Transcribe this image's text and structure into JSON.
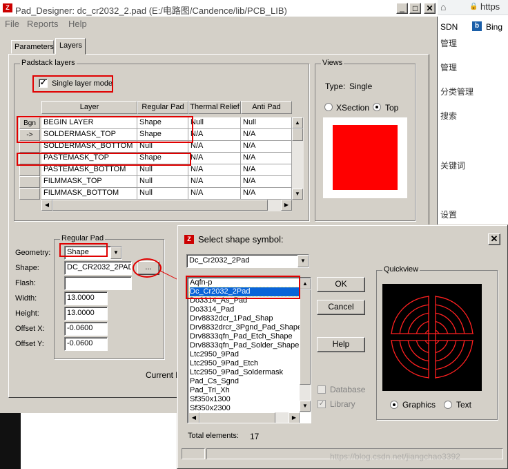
{
  "main_window": {
    "title": "Pad_Designer: dc_cr2032_2.pad (E:/电路图/Candence/lib/PCB_LIB)",
    "menu": [
      "File",
      "Reports",
      "Help"
    ],
    "tabs": [
      "Parameters",
      "Layers"
    ],
    "padstack_group": "Padstack layers",
    "single_layer_mode": "Single layer mode",
    "columns": [
      "Layer",
      "Regular Pad",
      "Thermal Relief",
      "Anti Pad"
    ],
    "rows": [
      {
        "btn": "Bgn",
        "layer": "BEGIN LAYER",
        "regular": "Shape",
        "thermal": "Null",
        "anti": "Null"
      },
      {
        "btn": "->",
        "layer": "SOLDERMASK_TOP",
        "regular": "Shape",
        "thermal": "N/A",
        "anti": "N/A"
      },
      {
        "btn": "",
        "layer": "SOLDERMASK_BOTTOM",
        "regular": "Null",
        "thermal": "N/A",
        "anti": "N/A"
      },
      {
        "btn": "",
        "layer": "PASTEMASK_TOP",
        "regular": "Shape",
        "thermal": "N/A",
        "anti": "N/A"
      },
      {
        "btn": "",
        "layer": "PASTEMASK_BOTTOM",
        "regular": "Null",
        "thermal": "N/A",
        "anti": "N/A"
      },
      {
        "btn": "",
        "layer": "FILMMASK_TOP",
        "regular": "Null",
        "thermal": "N/A",
        "anti": "N/A"
      },
      {
        "btn": "",
        "layer": "FILMMASK_BOTTOM",
        "regular": "Null",
        "thermal": "N/A",
        "anti": "N/A"
      }
    ],
    "views": {
      "title": "Views",
      "type_label": "Type:",
      "type_value": "Single",
      "xsection": "XSection",
      "top": "Top",
      "pad_color": "#ff0000"
    },
    "regular_pad": {
      "title": "Regular Pad",
      "geometry_label": "Geometry:",
      "geometry_value": "Shape",
      "shape_label": "Shape:",
      "shape_value": "DC_CR2032_2PAD",
      "browse": "...",
      "flash_label": "Flash:",
      "flash_value": "",
      "width_label": "Width:",
      "width_value": "13.0000",
      "height_label": "Height:",
      "height_value": "13.0000",
      "offx_label": "Offset X:",
      "offx_value": "-0.0600",
      "offy_label": "Offset Y:",
      "offy_value": "-0.0600"
    },
    "current_layer_partial": "Current la"
  },
  "browser_fragment": {
    "url_partial": "https",
    "bookmarks": [
      "SDN",
      "Bing"
    ],
    "sidebar_fragments": [
      "管理",
      "管理",
      "分类管理",
      "搜索",
      "关键词",
      "设置"
    ]
  },
  "dialog": {
    "title": "Select shape symbol:",
    "combo_value": "Dc_Cr2032_2Pad",
    "items": [
      "Aqfn-p",
      "Dc_Cr2032_2Pad",
      "Do3314_As_Pad",
      "Do3314_Pad",
      "Drv8832dcr_1Pad_Shap",
      "Drv8832drcr_3Pgnd_Pad_Shape",
      "Drv8833qfn_Pad_Etch_Shape",
      "Drv8833qfn_Pad_Solder_Shape",
      "Ltc2950_9Pad",
      "Ltc2950_9Pad_Etch",
      "Ltc2950_9Pad_Soldermask",
      "Pad_Cs_Sgnd",
      "Pad_Tri_Xh",
      "Sf350x1300",
      "Sf350x2300"
    ],
    "selected_index": 1,
    "ok": "OK",
    "cancel": "Cancel",
    "help": "Help",
    "database": "Database",
    "library": "Library",
    "quickview": "Quickview",
    "graphics": "Graphics",
    "text": "Text",
    "total_label": "Total elements:",
    "total_value": "17"
  },
  "watermark": "https://blog.csdn.net/jiangchao3392",
  "colors": {
    "accent_red": "#e00000",
    "selection": "#0a64d8",
    "window_bg": "#d4d0c8",
    "quickview_bg": "#000000"
  }
}
